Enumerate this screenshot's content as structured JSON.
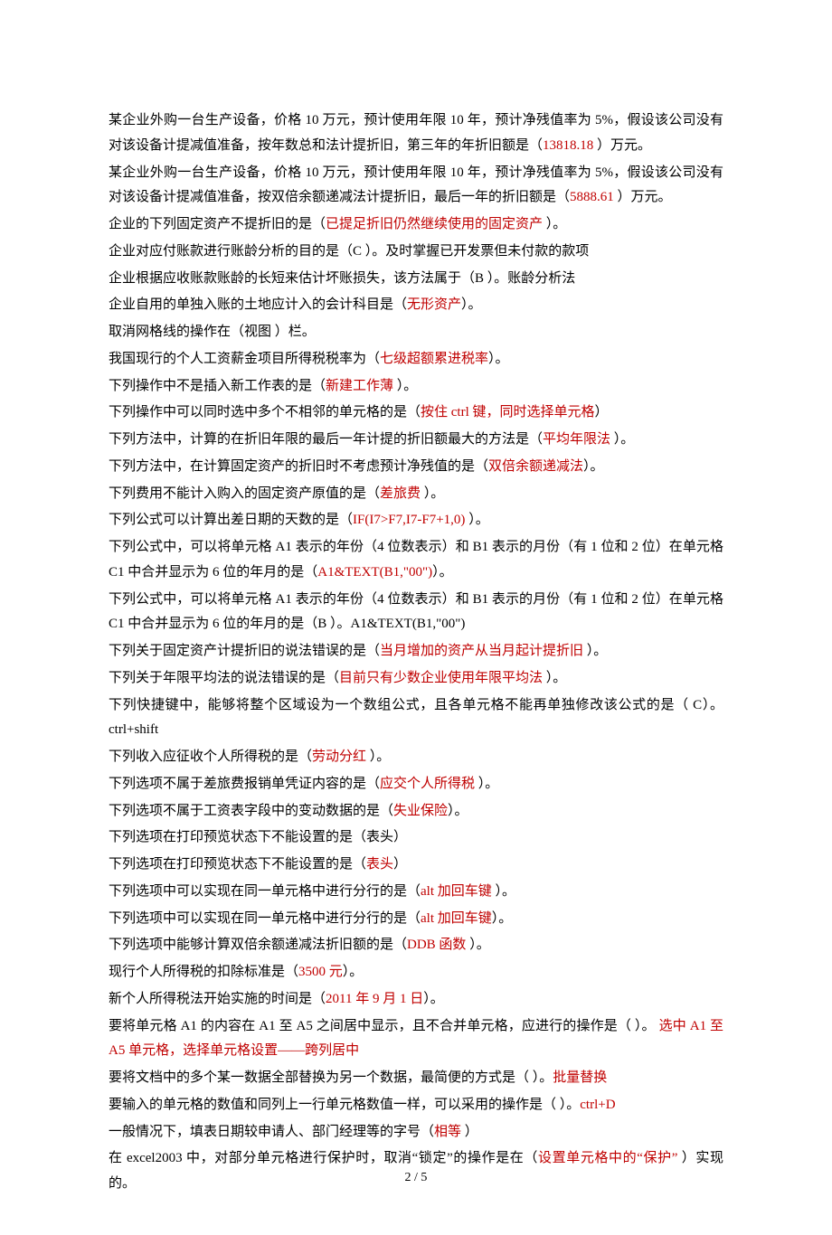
{
  "lines": [
    {
      "segments": [
        {
          "t": "某企业外购一台生产设备，价格 10 万元，预计使用年限 10 年，预计净残值率为 5%，假设该公司没有对该设备计提减值准备，按年数总和法计提折旧，第三年的年折旧额是（"
        },
        {
          "t": "13818.18 ",
          "ans": true
        },
        {
          "t": "）万元。"
        }
      ]
    },
    {
      "segments": [
        {
          "t": "某企业外购一台生产设备，价格 10 万元，预计使用年限 10 年，预计净残值率为 5%，假设该公司没有对该设备计提减值准备，按双倍余额递减法计提折旧，最后一年的折旧额是（"
        },
        {
          "t": "5888.61 ",
          "ans": true
        },
        {
          "t": "）万元。"
        }
      ]
    },
    {
      "segments": [
        {
          "t": "企业的下列固定资产不提折旧的是（"
        },
        {
          "t": "已提足折旧仍然继续使用的固定资产 ",
          "ans": true
        },
        {
          "t": "）。"
        }
      ]
    },
    {
      "segments": [
        {
          "t": "企业对应付账款进行账龄分析的目的是（C ）。及时掌握已开发票但未付款的款项"
        }
      ]
    },
    {
      "segments": [
        {
          "t": "企业根据应收账款账龄的长短来估计坏账损失，该方法属于（B ）。账龄分析法"
        }
      ]
    },
    {
      "segments": [
        {
          "t": "企业自用的单独入账的土地应计入的会计科目是（"
        },
        {
          "t": "无形资产",
          "ans": true
        },
        {
          "t": "）。"
        }
      ]
    },
    {
      "segments": [
        {
          "t": "取消网格线的操作在（视图 ）栏。"
        }
      ]
    },
    {
      "segments": [
        {
          "t": "我国现行的个人工资薪金项目所得税税率为（"
        },
        {
          "t": "七级超额累进税率",
          "ans": true
        },
        {
          "t": "）。"
        }
      ]
    },
    {
      "segments": [
        {
          "t": "下列操作中不是插入新工作表的是（"
        },
        {
          "t": "新建工作薄 ",
          "ans": true
        },
        {
          "t": "）。"
        }
      ]
    },
    {
      "segments": [
        {
          "t": "下列操作中可以同时选中多个不相邻的单元格的是（"
        },
        {
          "t": "按住 ctrl 键，同时选择单元格",
          "ans": true
        },
        {
          "t": "）"
        }
      ]
    },
    {
      "segments": [
        {
          "t": "下列方法中，计算的在折旧年限的最后一年计提的折旧额最大的方法是（"
        },
        {
          "t": "平均年限法 ",
          "ans": true
        },
        {
          "t": "）。"
        }
      ]
    },
    {
      "segments": [
        {
          "t": "下列方法中，在计算固定资产的折旧时不考虑预计净残值的是（"
        },
        {
          "t": "双倍余额递减法",
          "ans": true
        },
        {
          "t": "）。"
        }
      ]
    },
    {
      "segments": [
        {
          "t": "下列费用不能计入购入的固定资产原值的是（"
        },
        {
          "t": "差旅费 ",
          "ans": true
        },
        {
          "t": "）。"
        }
      ]
    },
    {
      "segments": [
        {
          "t": "下列公式可以计算出差日期的天数的是（"
        },
        {
          "t": "IF(I7>F7,I7-F7+1,0)   ",
          "ans": true
        },
        {
          "t": "）。"
        }
      ]
    },
    {
      "segments": [
        {
          "t": "下列公式中，可以将单元格 A1 表示的年份（4 位数表示）和 B1 表示的月份（有 1 位和 2 位）在单元格 C1 中合并显示为 6 位的年月的是（"
        },
        {
          "t": "A1&TEXT(B1,\"00\")",
          "ans": true
        },
        {
          "t": "）。"
        }
      ]
    },
    {
      "segments": [
        {
          "t": "下列公式中，可以将单元格 A1 表示的年份（4 位数表示）和 B1 表示的月份（有 1 位和 2 位）在单元格 C1 中合并显示为 6 位的年月的是（B  ）。A1&TEXT(B1,\"00\")"
        }
      ]
    },
    {
      "segments": [
        {
          "t": "下列关于固定资产计提折旧的说法错误的是（"
        },
        {
          "t": "当月增加的资产从当月起计提折旧 ",
          "ans": true
        },
        {
          "t": "）。"
        }
      ]
    },
    {
      "segments": [
        {
          "t": "下列关于年限平均法的说法错误的是（"
        },
        {
          "t": "目前只有少数企业使用年限平均法 ",
          "ans": true
        },
        {
          "t": "）。"
        }
      ]
    },
    {
      "segments": [
        {
          "t": "下列快捷键中，能够将整个区域设为一个数组公式，且各单元格不能再单独修改该公式的是（ C）。ctrl+shift"
        }
      ]
    },
    {
      "segments": [
        {
          "t": "下列收入应征收个人所得税的是（"
        },
        {
          "t": "劳动分红 ",
          "ans": true
        },
        {
          "t": "）。"
        }
      ]
    },
    {
      "segments": [
        {
          "t": "下列选项不属于差旅费报销单凭证内容的是（"
        },
        {
          "t": "应交个人所得税 ",
          "ans": true
        },
        {
          "t": "）。"
        }
      ]
    },
    {
      "segments": [
        {
          "t": "下列选项不属于工资表字段中的变动数据的是（"
        },
        {
          "t": "失业保险",
          "ans": true
        },
        {
          "t": "）。"
        }
      ]
    },
    {
      "segments": [
        {
          "t": "下列选项在打印预览状态下不能设置的是（表头）"
        }
      ]
    },
    {
      "segments": [
        {
          "t": "下列选项在打印预览状态下不能设置的是（"
        },
        {
          "t": "表头",
          "ans": true
        },
        {
          "t": "）"
        }
      ]
    },
    {
      "segments": [
        {
          "t": "下列选项中可以实现在同一单元格中进行分行的是（"
        },
        {
          "t": "alt 加回车键 ",
          "ans": true
        },
        {
          "t": "）。"
        }
      ]
    },
    {
      "segments": [
        {
          "t": "下列选项中可以实现在同一单元格中进行分行的是（"
        },
        {
          "t": "alt 加回车键",
          "ans": true
        },
        {
          "t": "）。"
        }
      ]
    },
    {
      "segments": [
        {
          "t": "下列选项中能够计算双倍余额递减法折旧额的是（"
        },
        {
          "t": "DDB 函数 ",
          "ans": true
        },
        {
          "t": "）。"
        }
      ]
    },
    {
      "segments": [
        {
          "t": "现行个人所得税的扣除标准是（"
        },
        {
          "t": "3500 元",
          "ans": true
        },
        {
          "t": "）。"
        }
      ]
    },
    {
      "segments": [
        {
          "t": "新个人所得税法开始实施的时间是（"
        },
        {
          "t": "2011 年 9 月 1 日",
          "ans": true
        },
        {
          "t": "）。"
        }
      ]
    },
    {
      "segments": [
        {
          "t": "要将单元格 A1 的内容在 A1 至 A5 之间居中显示，且不合并单元格，应进行的操作是（ ）。 "
        },
        {
          "t": "选中 A1 至 A5 单元格，选择单元格设置——跨列居中",
          "ans": true
        }
      ]
    },
    {
      "segments": [
        {
          "t": "要将文档中的多个某一数据全部替换为另一个数据，最简便的方式是（ ）。"
        },
        {
          "t": "批量替换",
          "ans": true
        }
      ]
    },
    {
      "segments": [
        {
          "t": "要输入的单元格的数值和同列上一行单元格数值一样，可以采用的操作是（ ）。"
        },
        {
          "t": "ctrl+D",
          "ans": true
        }
      ]
    },
    {
      "segments": [
        {
          "t": "一般情况下，填表日期较申请人、部门经理等的字号（"
        },
        {
          "t": "相等 ",
          "ans": true
        },
        {
          "t": "）"
        }
      ]
    },
    {
      "segments": [
        {
          "t": "在 excel2003 中，对部分单元格进行保护时，取消“锁定”的操作是在（"
        },
        {
          "t": "设置单元格中的“保护”   ",
          "ans": true
        },
        {
          "t": "）实现的。"
        }
      ]
    }
  ],
  "footer": "2 / 5"
}
